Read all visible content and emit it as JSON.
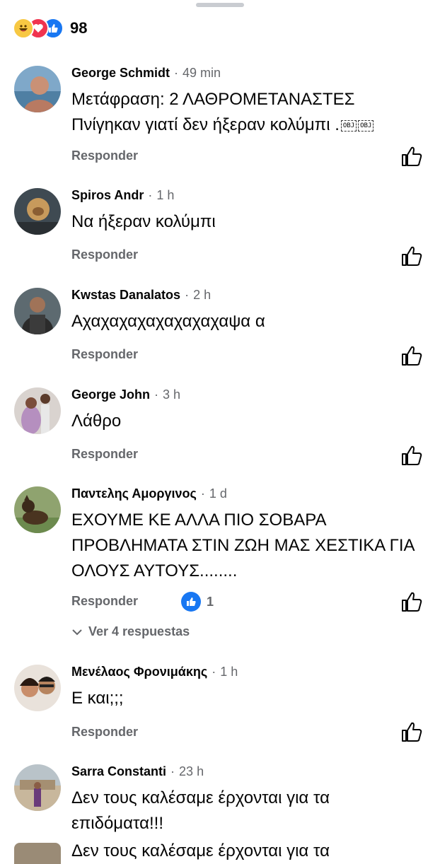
{
  "reactions": {
    "count": "98",
    "icons": [
      "haha-icon",
      "love-icon",
      "like-icon"
    ]
  },
  "comments": [
    {
      "name": "George Schmidt",
      "time": "49 min",
      "text": "Μετάφραση: 2 ΛΑΘΡΟΜΕΤΑΝΑΣΤΕΣ Πνίγηκαν γιατί δεν ήξεραν κολύμπι .",
      "obj": "OBJ",
      "reply": "Responder"
    },
    {
      "name": "Spiros Andr",
      "time": "1 h",
      "text": "Να ήξεραν κολύμπι",
      "reply": "Responder"
    },
    {
      "name": "Kwstas Danalatos",
      "time": "2 h",
      "text": "Αχαχαχαχαχαχαχαχαψα α",
      "reply": "Responder"
    },
    {
      "name": "George John",
      "time": "3 h",
      "text": "Λάθρο",
      "reply": "Responder"
    },
    {
      "name": "Παντελης Αμοργινος",
      "time": "1 d",
      "text": "ΕΧΟΥΜΕ ΚΕ ΑΛΛΑ ΠΙΟ ΣΟΒΑΡΑ ΠΡΟΒΛΗΜΑΤΑ ΣΤΙΝ ΖΩΗ ΜΑΣ ΧΕΣΤΙΚΑ ΓΙΑ ΟΛΟΥΣ ΑΥΤΟΥΣ........",
      "reply": "Responder",
      "like_count": "1",
      "view_replies": "Ver 4 respuestas"
    },
    {
      "name": "Μενέλαος Φρονιμάκης",
      "time": "1 h",
      "text": "Ε και;;;",
      "reply": "Responder"
    },
    {
      "name": "Sarra Constanti",
      "time": "23 h",
      "text": "Δεν τους καλέσαμε έρχονται για τα επιδόματα!!!",
      "reply": ""
    }
  ],
  "partial_text": "Δεν τους καλέσαμε έρχονται για τα",
  "colors": {
    "accent": "#1877f2",
    "secondary_text": "#65676b",
    "primary_text": "#050505"
  }
}
